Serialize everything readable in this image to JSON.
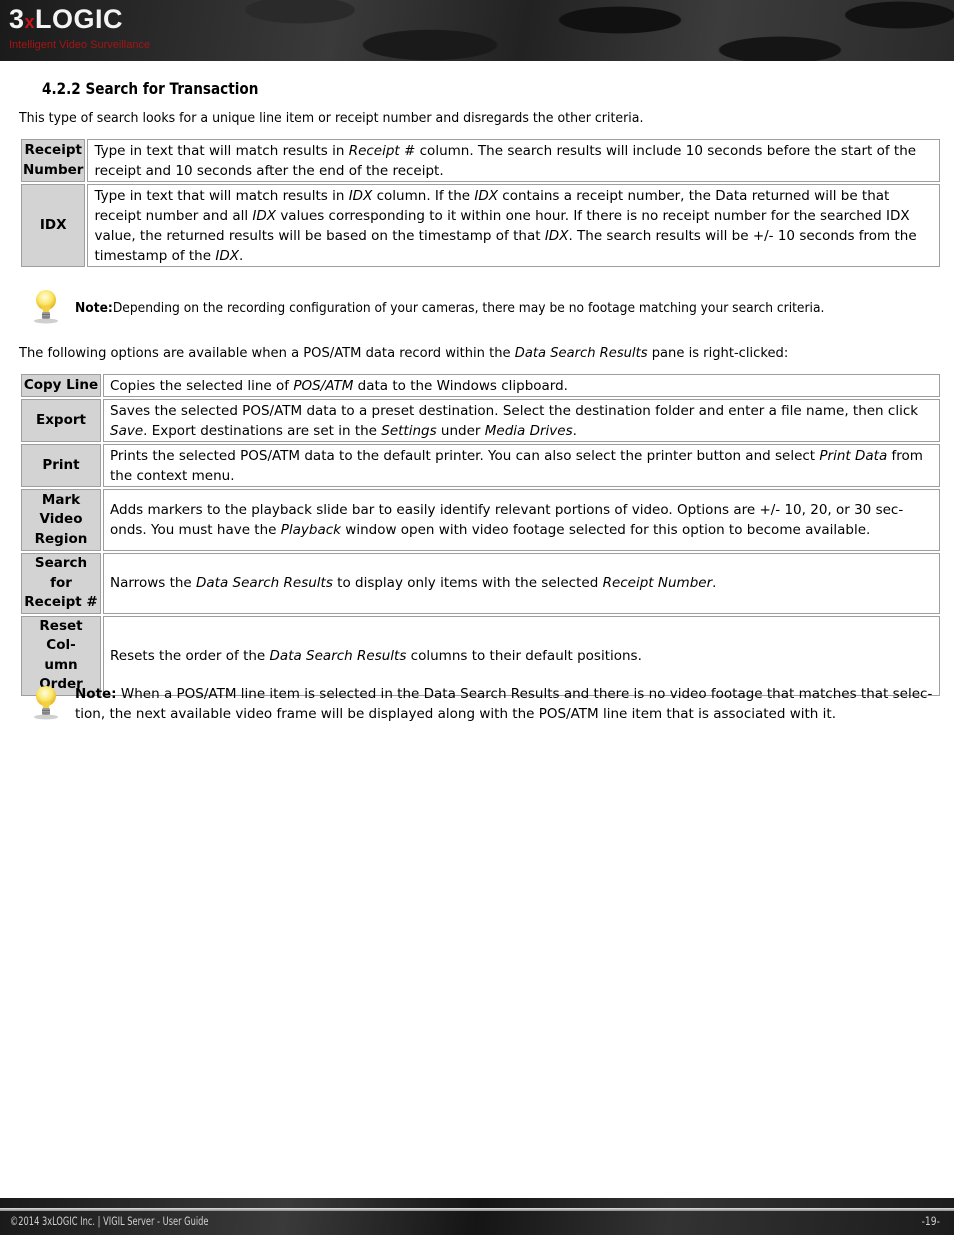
{
  "header": {
    "logo_text_a": "3",
    "logo_text_x": "x",
    "logo_text_b": "LOGIC",
    "tagline": "Intelligent Video Surveillance",
    "colors": {
      "brand_red": "#c8151b",
      "tagline_red": "#a31515"
    }
  },
  "section": {
    "title": "4.2.2 Search for Transaction",
    "intro": "This type of search looks for a unique line item or receipt number and disregards the other criteria."
  },
  "criteria_table": [
    {
      "key_lines": [
        "Receipt",
        "Number"
      ],
      "desc": [
        {
          "t": "Type in text that will match results in "
        },
        {
          "t": "Receipt #",
          "i": true
        },
        {
          "t": " column. The search results will include 10 seconds before the start of the receipt and 10 seconds after the end of the receipt."
        }
      ]
    },
    {
      "key_lines": [
        "IDX"
      ],
      "desc": [
        {
          "t": "Type in text that will match results in "
        },
        {
          "t": "IDX",
          "i": true
        },
        {
          "t": " column. If the "
        },
        {
          "t": "IDX",
          "i": true
        },
        {
          "t": " contains a receipt number, the Data returned will be that receipt number and all "
        },
        {
          "t": "IDX",
          "i": true
        },
        {
          "t": " values corresponding to it within one hour. If there is no receipt number for the searched IDX value, the returned results will be based on the timestamp of that "
        },
        {
          "t": "IDX",
          "i": true
        },
        {
          "t": ". The search results will be +/- 10 seconds from the timestamp of the "
        },
        {
          "t": "IDX",
          "i": true
        },
        {
          "t": "."
        }
      ]
    }
  ],
  "note1": {
    "label": "Note:",
    "text": "Depending on the recording configuration of your cameras, there may be no footage matching your search criteria."
  },
  "options_intro": {
    "before": "The following options are available when a POS/ATM data record within the ",
    "em": "Data Search Results",
    "after": " pane is right-clicked:"
  },
  "options_table": [
    {
      "key_lines": [
        "Copy Line"
      ],
      "desc": [
        {
          "t": "Copies the selected line of "
        },
        {
          "t": "POS/ATM",
          "i": true
        },
        {
          "t": " data to the Windows clipboard."
        }
      ]
    },
    {
      "key_lines": [
        "Export"
      ],
      "desc": [
        {
          "t": "Saves the selected POS/ATM data to a preset destination. Select the destination folder and enter a file name, then click "
        },
        {
          "t": "Save",
          "i": true
        },
        {
          "t": ". Export destinations are set in the "
        },
        {
          "t": "Settings",
          "i": true
        },
        {
          "t": " under "
        },
        {
          "t": "Media Drives",
          "i": true
        },
        {
          "t": "."
        }
      ]
    },
    {
      "key_lines": [
        "Print"
      ],
      "desc": [
        {
          "t": "Prints the selected POS/ATM data to the default printer. You can also select the printer button and select "
        },
        {
          "t": "Print Data",
          "i": true
        },
        {
          "t": " from the context menu."
        }
      ]
    },
    {
      "key_lines": [
        "Mark",
        "Video",
        "Region"
      ],
      "desc": [
        {
          "t": "Adds markers to the playback slide bar to easily identify relevant portions of video. Options are +/- 10, 20, or 30 sec-onds. You must have the "
        },
        {
          "t": "Playback",
          "i": true
        },
        {
          "t": " window open with video footage selected for this option to become available."
        }
      ]
    },
    {
      "key_lines": [
        "Search for",
        "Receipt #"
      ],
      "desc": [
        {
          "t": "Narrows the "
        },
        {
          "t": "Data Search Results",
          "i": true
        },
        {
          "t": " to display only items with the selected "
        },
        {
          "t": "Receipt Number",
          "i": true
        },
        {
          "t": "."
        }
      ]
    },
    {
      "key_lines": [
        "Reset Col-",
        "umn",
        "Order"
      ],
      "desc": [
        {
          "t": "Resets the order of the "
        },
        {
          "t": "Data Search Results",
          "i": true
        },
        {
          "t": " columns to their default positions."
        }
      ]
    }
  ],
  "note2": {
    "label": "Note:",
    "text": " When a POS/ATM line item is selected in the Data Search Results and there is no video footage that matches that selec-tion, the next available video frame will be displayed along with the POS/ATM line item that is associated with it."
  },
  "footer": {
    "copyright": "©2014 3xLOGIC Inc. | VIGIL Server - User Guide",
    "page_number": "-19-"
  },
  "icons": {
    "note_icon": "lightbulb-icon"
  }
}
